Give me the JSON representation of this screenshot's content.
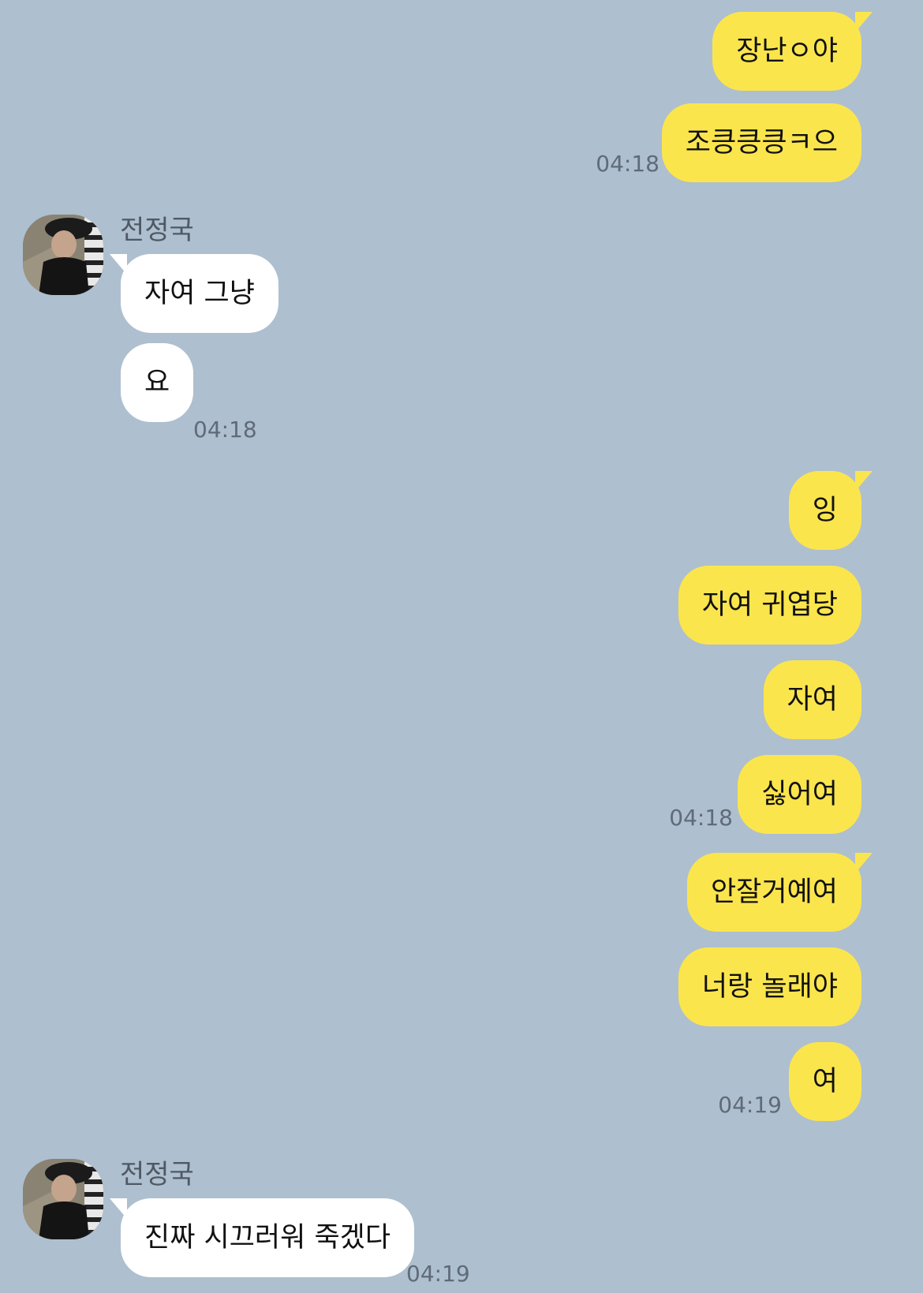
{
  "chat": {
    "my_messages_group1": [
      "장난ㅇ야",
      "조킁킁킁ㅋ으"
    ],
    "time_1": "04:18",
    "other_group1": {
      "sender": "전정국",
      "messages": [
        "자여 그냥",
        "요"
      ],
      "time": "04:18"
    },
    "my_messages_group2": [
      "잉",
      "자여 귀엽당",
      "자여",
      "싫어여"
    ],
    "time_2": "04:18",
    "my_messages_group3": [
      "안잘거예여",
      "너랑 놀래야",
      "여"
    ],
    "time_3": "04:19",
    "other_group2": {
      "sender": "전정국",
      "messages": [
        "진짜 시끄러워 죽겠다"
      ],
      "time": "04:19"
    }
  },
  "colors": {
    "background": "#aebfcf",
    "my_bubble": "#fbe54d",
    "other_bubble": "#ffffff",
    "timestamp": "#5f6b78",
    "sender_name": "#4f5964"
  },
  "icons": {
    "avatar": "profile-photo"
  }
}
